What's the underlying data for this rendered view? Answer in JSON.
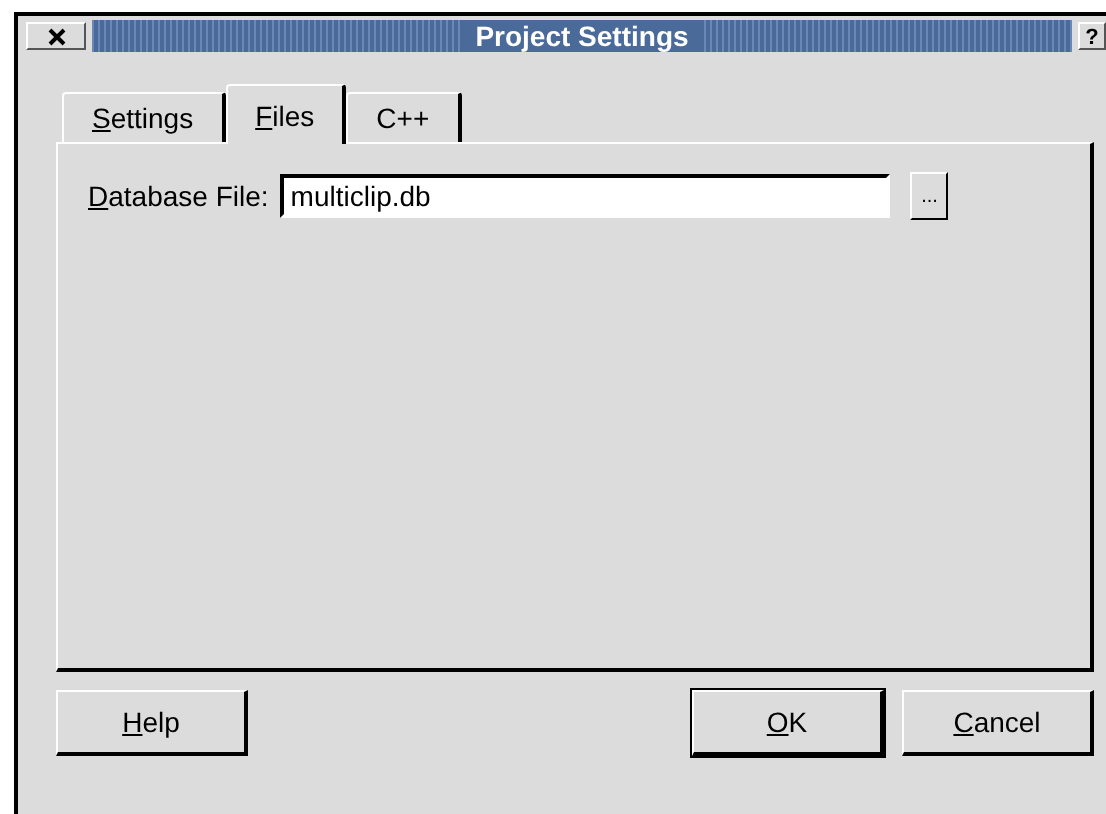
{
  "window": {
    "title": "Project Settings",
    "help_glyph": "?"
  },
  "tabs": [
    {
      "label": [
        {
          "text": "S",
          "mnemonic": true
        },
        {
          "text": "ettings",
          "mnemonic": false
        }
      ],
      "selected": false
    },
    {
      "label": [
        {
          "text": "F",
          "mnemonic": true
        },
        {
          "text": "iles",
          "mnemonic": false
        }
      ],
      "selected": true
    },
    {
      "label": [
        {
          "text": "C++",
          "mnemonic": false
        }
      ],
      "selected": false
    }
  ],
  "database_file": {
    "label": [
      {
        "text": "D",
        "mnemonic": true
      },
      {
        "text": "atabase File:",
        "mnemonic": false
      }
    ],
    "value": "multiclip.db",
    "browse": "..."
  },
  "left_buttons": [
    {
      "label": [
        {
          "text": "H",
          "mnemonic": true
        },
        {
          "text": "elp",
          "mnemonic": false
        }
      ],
      "default": false
    }
  ],
  "right_buttons": [
    {
      "label": [
        {
          "text": "O",
          "mnemonic": true
        },
        {
          "text": "K",
          "mnemonic": false
        }
      ],
      "default": true
    },
    {
      "label": [
        {
          "text": "C",
          "mnemonic": true
        },
        {
          "text": "ancel",
          "mnemonic": false
        }
      ],
      "default": false
    }
  ]
}
